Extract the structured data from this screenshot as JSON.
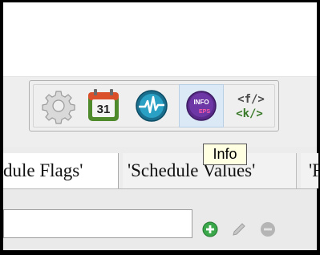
{
  "toolbar": {
    "buttons": [
      {
        "id": "settings",
        "icon": "gear-icon"
      },
      {
        "id": "calendar",
        "icon": "calendar-icon",
        "label": "31"
      },
      {
        "id": "monitor",
        "icon": "pulse-icon"
      },
      {
        "id": "info",
        "icon": "info-eps-icon",
        "label_top": "INFO",
        "label_bottom": "EPS",
        "hovered": true
      },
      {
        "id": "code",
        "icon": "code-tags-icon",
        "line1": "<f/>",
        "line2": "<k/>"
      }
    ]
  },
  "tooltip": {
    "text": "Info"
  },
  "tabs": [
    {
      "label": "dule Flags'",
      "selected": true
    },
    {
      "label": "'Schedule Values'",
      "selected": false
    },
    {
      "label": "'F",
      "selected": false
    }
  ],
  "search": {
    "value": "",
    "placeholder": ""
  },
  "colors": {
    "add_green": "#3aa84a",
    "disabled_gray": "#b5b5b5",
    "hover_blue": "#dbe9f6",
    "tooltip_bg": "#ffffe1"
  }
}
